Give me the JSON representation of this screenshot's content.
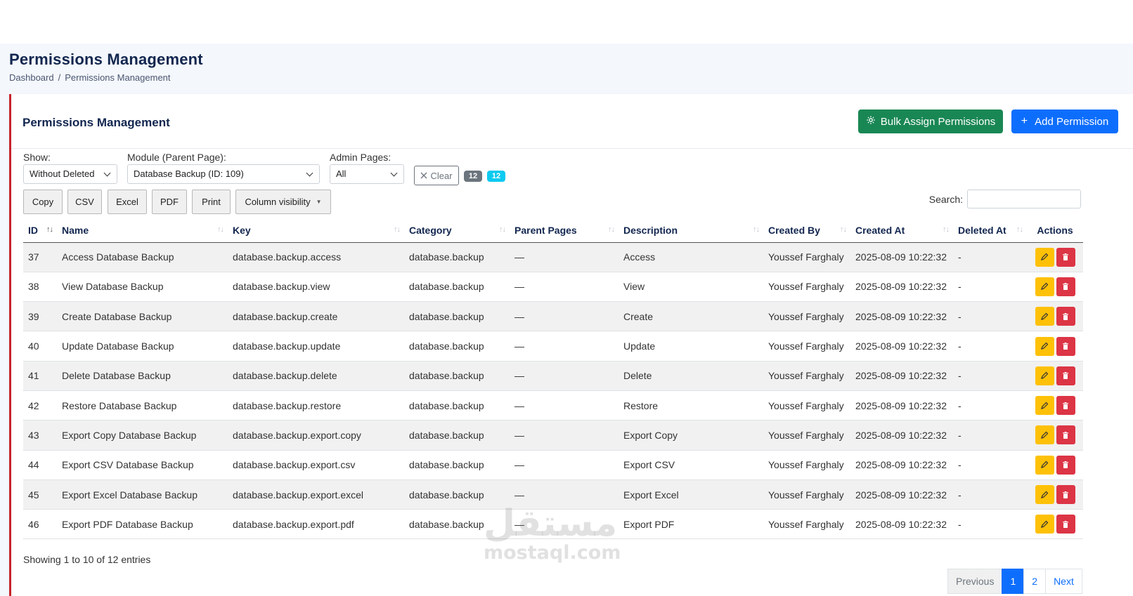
{
  "page": {
    "title": "Permissions Management",
    "breadcrumb": [
      "Dashboard",
      "Permissions Management"
    ],
    "breadcrumb_separator": "/"
  },
  "card": {
    "title": "Permissions Management",
    "bulk_assign_label": "Bulk Assign Permissions",
    "add_permission_label": "Add Permission"
  },
  "filters": {
    "show_label": "Show:",
    "show_value": "Without Deleted",
    "module_label": "Module (Parent Page):",
    "module_value": "Database Backup (ID: 109)",
    "admin_pages_label": "Admin Pages:",
    "admin_pages_value": "All",
    "clear_label": "Clear",
    "count_badge_1": "12",
    "count_badge_2": "12"
  },
  "toolbar": {
    "copy": "Copy",
    "csv": "CSV",
    "excel": "Excel",
    "pdf": "PDF",
    "print": "Print",
    "column_visibility": "Column visibility",
    "search_label": "Search:",
    "search_value": ""
  },
  "table": {
    "columns": [
      "ID",
      "Name",
      "Key",
      "Category",
      "Parent Pages",
      "Description",
      "Created By",
      "Created At",
      "Deleted At",
      "Actions"
    ],
    "rows": [
      {
        "id": "37",
        "name": "Access Database Backup",
        "key": "database.backup.access",
        "category": "database.backup",
        "parent": "—",
        "description": "Access",
        "created_by": "Youssef Farghaly",
        "created_at": "2025-08-09 10:22:32",
        "deleted_at": "-"
      },
      {
        "id": "38",
        "name": "View Database Backup",
        "key": "database.backup.view",
        "category": "database.backup",
        "parent": "—",
        "description": "View",
        "created_by": "Youssef Farghaly",
        "created_at": "2025-08-09 10:22:32",
        "deleted_at": "-"
      },
      {
        "id": "39",
        "name": "Create Database Backup",
        "key": "database.backup.create",
        "category": "database.backup",
        "parent": "—",
        "description": "Create",
        "created_by": "Youssef Farghaly",
        "created_at": "2025-08-09 10:22:32",
        "deleted_at": "-"
      },
      {
        "id": "40",
        "name": "Update Database Backup",
        "key": "database.backup.update",
        "category": "database.backup",
        "parent": "—",
        "description": "Update",
        "created_by": "Youssef Farghaly",
        "created_at": "2025-08-09 10:22:32",
        "deleted_at": "-"
      },
      {
        "id": "41",
        "name": "Delete Database Backup",
        "key": "database.backup.delete",
        "category": "database.backup",
        "parent": "—",
        "description": "Delete",
        "created_by": "Youssef Farghaly",
        "created_at": "2025-08-09 10:22:32",
        "deleted_at": "-"
      },
      {
        "id": "42",
        "name": "Restore Database Backup",
        "key": "database.backup.restore",
        "category": "database.backup",
        "parent": "—",
        "description": "Restore",
        "created_by": "Youssef Farghaly",
        "created_at": "2025-08-09 10:22:32",
        "deleted_at": "-"
      },
      {
        "id": "43",
        "name": "Export Copy Database Backup",
        "key": "database.backup.export.copy",
        "category": "database.backup",
        "parent": "—",
        "description": "Export Copy",
        "created_by": "Youssef Farghaly",
        "created_at": "2025-08-09 10:22:32",
        "deleted_at": "-"
      },
      {
        "id": "44",
        "name": "Export CSV Database Backup",
        "key": "database.backup.export.csv",
        "category": "database.backup",
        "parent": "—",
        "description": "Export CSV",
        "created_by": "Youssef Farghaly",
        "created_at": "2025-08-09 10:22:32",
        "deleted_at": "-"
      },
      {
        "id": "45",
        "name": "Export Excel Database Backup",
        "key": "database.backup.export.excel",
        "category": "database.backup",
        "parent": "—",
        "description": "Export Excel",
        "created_by": "Youssef Farghaly",
        "created_at": "2025-08-09 10:22:32",
        "deleted_at": "-"
      },
      {
        "id": "46",
        "name": "Export PDF Database Backup",
        "key": "database.backup.export.pdf",
        "category": "database.backup",
        "parent": "—",
        "description": "Export PDF",
        "created_by": "Youssef Farghaly",
        "created_at": "2025-08-09 10:22:32",
        "deleted_at": "-"
      }
    ]
  },
  "footer": {
    "info": "Showing 1 to 10 of 12 entries",
    "previous": "Previous",
    "pages": [
      "1",
      "2"
    ],
    "next": "Next"
  },
  "watermark": {
    "arabic": "مستقل",
    "latin": "mostaql.com"
  },
  "colors": {
    "bulk_button": "#198754",
    "add_button": "#0d6efd",
    "edit_button": "#ffc107",
    "delete_button": "#dc3545",
    "card_accent": "#c8232c",
    "title": "#12264f"
  }
}
